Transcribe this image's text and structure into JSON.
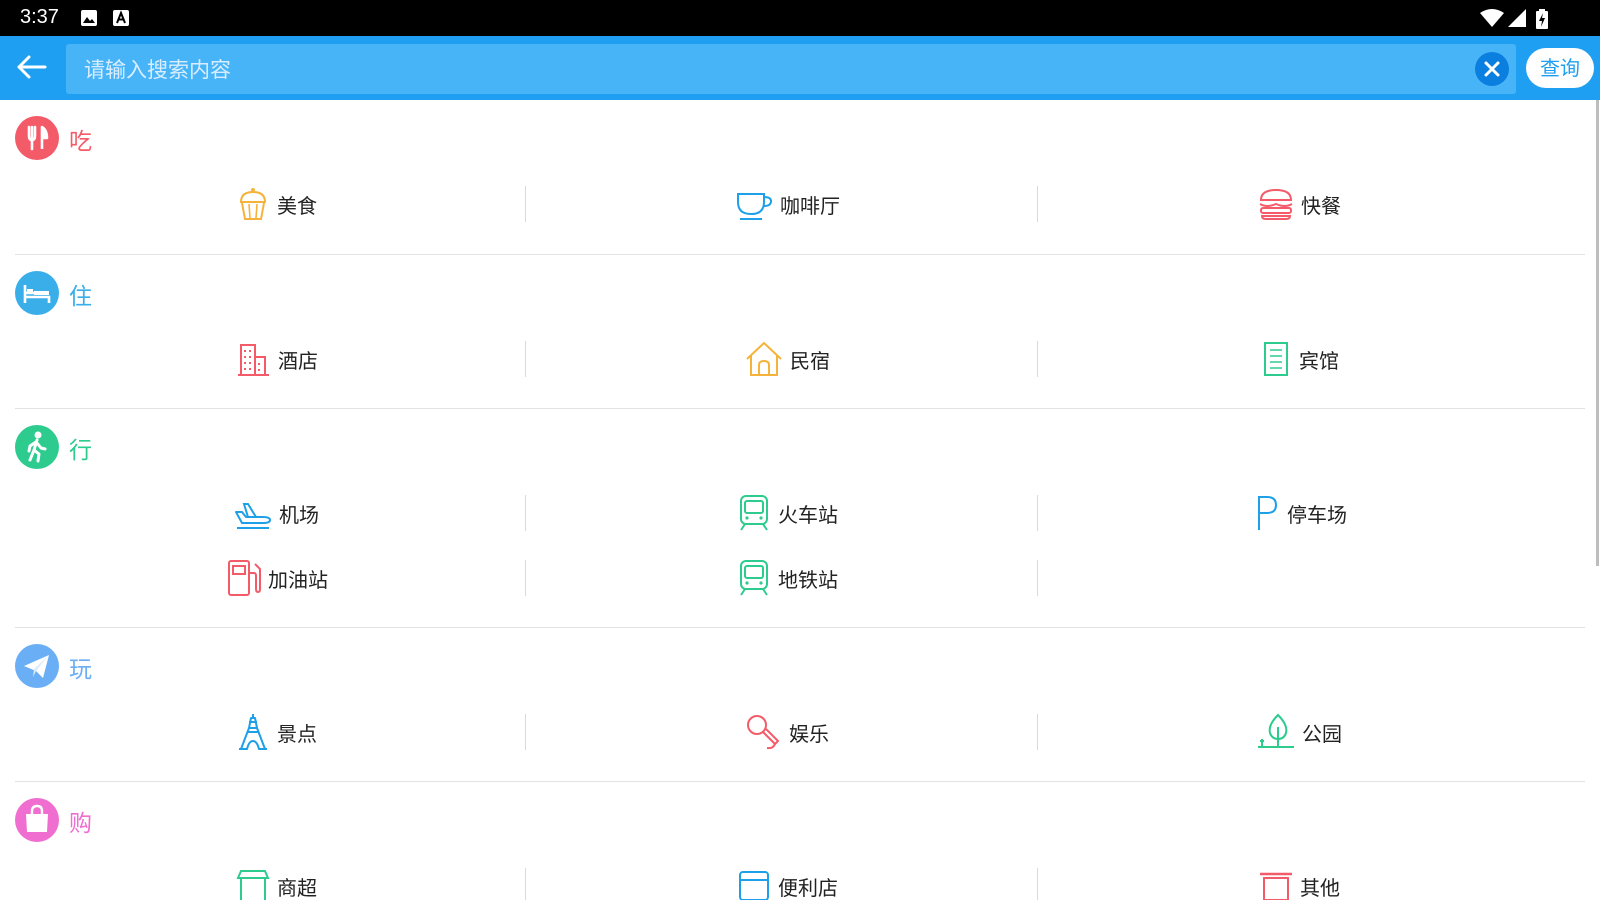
{
  "status_bar": {
    "time": "3:37"
  },
  "search": {
    "placeholder": "请输入搜索内容",
    "value": "",
    "query_label": "查询"
  },
  "colors": {
    "toolbar": "#1e9ff2",
    "eat": "#f45b69",
    "stay": "#3aaee8",
    "go": "#2ecb8f",
    "play": "#6aaef5",
    "shop": "#f06ed0"
  },
  "sections": [
    {
      "title": "吃",
      "icon": "fork-knife-icon",
      "items": [
        {
          "label": "美食",
          "icon": "cupcake-icon"
        },
        {
          "label": "咖啡厅",
          "icon": "coffee-cup-icon"
        },
        {
          "label": "快餐",
          "icon": "burger-icon"
        }
      ]
    },
    {
      "title": "住",
      "icon": "bed-icon",
      "items": [
        {
          "label": "酒店",
          "icon": "building-icon"
        },
        {
          "label": "民宿",
          "icon": "house-icon"
        },
        {
          "label": "宾馆",
          "icon": "document-building-icon"
        }
      ]
    },
    {
      "title": "行",
      "icon": "walking-person-icon",
      "items": [
        {
          "label": "机场",
          "icon": "airplane-icon"
        },
        {
          "label": "火车站",
          "icon": "train-icon"
        },
        {
          "label": "停车场",
          "icon": "parking-icon"
        },
        {
          "label": "加油站",
          "icon": "gas-station-icon"
        },
        {
          "label": "地铁站",
          "icon": "subway-icon"
        }
      ]
    },
    {
      "title": "玩",
      "icon": "paper-plane-icon",
      "items": [
        {
          "label": "景点",
          "icon": "tower-icon"
        },
        {
          "label": "娱乐",
          "icon": "microphone-icon"
        },
        {
          "label": "公园",
          "icon": "tree-icon"
        }
      ]
    },
    {
      "title": "购",
      "icon": "shopping-bag-icon",
      "items": [
        {
          "label": "商超",
          "icon": "store-icon"
        },
        {
          "label": "便利店",
          "icon": "shop-icon"
        },
        {
          "label": "其他",
          "icon": "other-icon"
        }
      ]
    }
  ]
}
